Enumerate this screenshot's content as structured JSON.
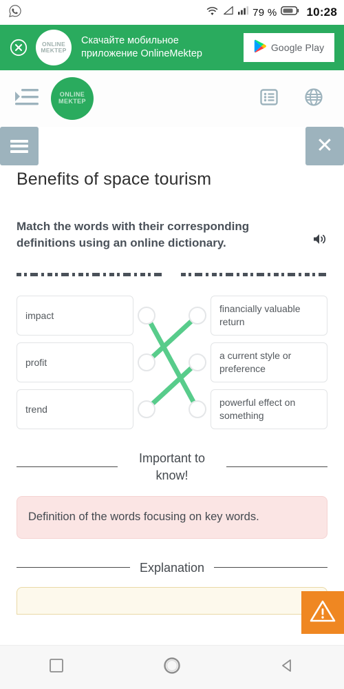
{
  "statusbar": {
    "notification_icon": "whatsapp-icon",
    "wifi_icon": "wifi-icon",
    "signal_triangle_icon": "signal-triangle-icon",
    "signal_bars_icon": "signal-bars-icon",
    "battery_text": "79 %",
    "battery_icon": "battery-icon",
    "clock": "10:28"
  },
  "promo": {
    "close_icon": "close-circle-icon",
    "logo_line1": "ONLINE",
    "logo_line2": "MEKTEP",
    "text_line1": "Скачайте мобильное",
    "text_line2": "приложение OnlineMektep",
    "store_button_label": "Google Play",
    "store_icon": "google-play-icon",
    "background_color": "#2aab5e"
  },
  "siteheader": {
    "menu_indent_icon": "indent-menu-icon",
    "logo_line1": "ONLINE",
    "logo_line2": "MEKTEP",
    "list_icon": "list-view-icon",
    "globe_icon": "globe-icon"
  },
  "menubar": {
    "burger_icon": "hamburger-menu-icon",
    "close_icon": "close-x-icon",
    "button_color": "#9db3bd"
  },
  "main": {
    "page_title": "Benefits of space tourism",
    "instruction": "Match the words with their corresponding definitions using an online dictionary.",
    "speaker_icon": "speaker-sound-icon"
  },
  "match": {
    "left_items": [
      {
        "label": "impact"
      },
      {
        "label": "profit"
      },
      {
        "label": "trend"
      }
    ],
    "right_items": [
      {
        "label": "financially valuable return"
      },
      {
        "label": "a current style or preference"
      },
      {
        "label": "powerful effect on something"
      }
    ],
    "connections": [
      {
        "from": 0,
        "to": 2
      },
      {
        "from": 1,
        "to": 0
      },
      {
        "from": 2,
        "to": 1
      }
    ],
    "line_color": "#58cc8b",
    "node_border_color": "#e4e6e8"
  },
  "important": {
    "heading": "Important to know!",
    "body": "Definition of the words focusing on key words.",
    "background_color": "#fbe5e4"
  },
  "explanation": {
    "heading": "Explanation",
    "background_color": "#fdf9ec"
  },
  "warning_fab": {
    "icon": "warning-triangle-icon",
    "color": "#ef8722"
  },
  "navbar": {
    "recents_icon": "square-recents-icon",
    "home_icon": "circle-home-icon",
    "back_icon": "triangle-back-icon"
  }
}
